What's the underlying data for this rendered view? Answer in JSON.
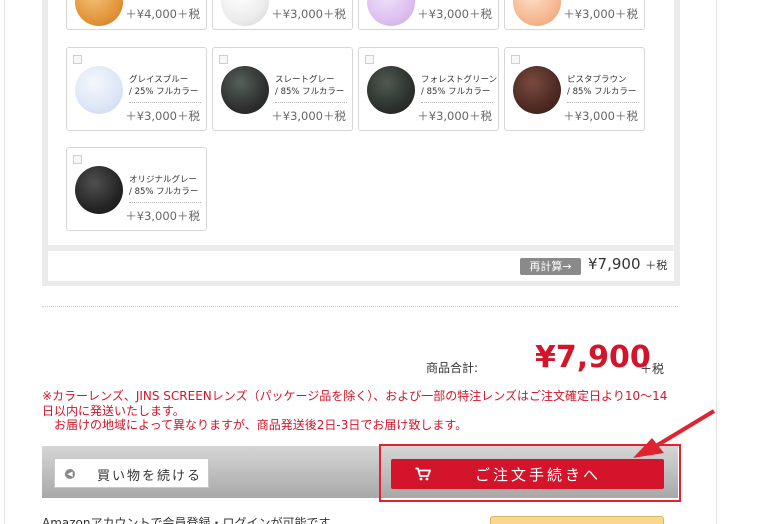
{
  "lenses_top_row": [
    {
      "price": "＋¥4,000＋税",
      "color": "#e3953a"
    },
    {
      "price": "＋¥3,000＋税",
      "color": "#ececec"
    },
    {
      "price": "＋¥3,000＋税",
      "color": "#ddc0ef"
    },
    {
      "price": "＋¥3,000＋税",
      "color": "#f6b891"
    }
  ],
  "lenses": [
    {
      "name1": "グレイスブルー",
      "name2": "/ 25% フルカラー",
      "price": "＋¥3,000＋税",
      "color": "#dce6f6"
    },
    {
      "name1": "スレートグレー",
      "name2": "/ 85% フルカラー",
      "price": "＋¥3,000＋税",
      "color": "#2e302f"
    },
    {
      "name1": "フォレストグリーン",
      "name2": "/ 85% フルカラー",
      "price": "＋¥3,000＋税",
      "color": "#2c312d"
    },
    {
      "name1": "ピスタブラウン",
      "name2": "/ 85% フルカラー",
      "price": "＋¥3,000＋税",
      "color": "#4d2a22"
    },
    {
      "name1": "オリジナルグレー",
      "name2": "/ 85% フルカラー",
      "price": "＋¥3,000＋税",
      "color": "#252525"
    }
  ],
  "recalc": {
    "button": "再計算→",
    "amount": "¥7,900",
    "tax": "＋税"
  },
  "subtotal": {
    "label": "商品合計:",
    "amount": "¥7,900",
    "tax": "＋税"
  },
  "notice": [
    "※カラーレンズ、JINS SCREENレンズ（パッケージ品を除く）、および一部の特注レンズはご注文確定日より10～14",
    "日以内に発送いたします。",
    "　お届けの地域によって異なりますが、商品発送後2日-3日でお届け致します。"
  ],
  "actions": {
    "continue": "買い物を続ける",
    "checkout": "ご注文手続きへ"
  },
  "amazon": {
    "text": "Amazonアカウントで会員登録・ログインが可能です。"
  },
  "colors": {
    "accent": "#d3142a",
    "annotation": "#e0232f"
  }
}
